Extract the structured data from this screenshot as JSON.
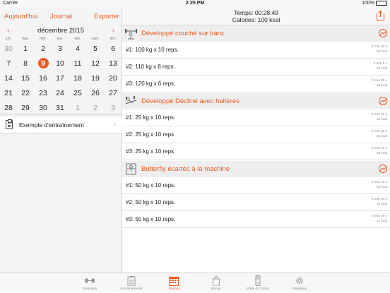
{
  "status": {
    "carrier": "Carrier",
    "time": "2:25 PM",
    "battery": "100%"
  },
  "left_nav": {
    "today": "Aujourd'hui",
    "journal": "Journal",
    "export": "Exporter"
  },
  "calendar": {
    "month": "décembre 2015",
    "weekdays": [
      "lun.",
      "mar.",
      "mer.",
      "jeu.",
      "ven.",
      "sam.",
      "dim."
    ],
    "weeks": [
      [
        "30",
        "1",
        "2",
        "3",
        "4",
        "5",
        "6"
      ],
      [
        "7",
        "8",
        "9",
        "10",
        "11",
        "12",
        "13"
      ],
      [
        "14",
        "15",
        "16",
        "17",
        "18",
        "19",
        "20"
      ],
      [
        "21",
        "22",
        "23",
        "24",
        "25",
        "26",
        "27"
      ],
      [
        "28",
        "29",
        "30",
        "31",
        "1",
        "2",
        "3"
      ]
    ],
    "muted_cells": [
      "0-0",
      "4-4",
      "4-5",
      "4-6"
    ],
    "today_cell": "1-2",
    "dot_cell": "1-2"
  },
  "workout_template": {
    "label": "Exemple d'entraînement"
  },
  "summary": {
    "time": "Temps: 00:28:49",
    "calories": "Calories: 100 kcal"
  },
  "exercises": [
    {
      "name": "Développé couché sur banc",
      "sets": [
        {
          "text": "#1: 100 kg x 10 reps.",
          "duration": "3 min 20 s",
          "kcal": "10 kcal"
        },
        {
          "text": "#2: 110 kg x 8 reps.",
          "duration": "4 min 5 s",
          "kcal": "12 kcal"
        },
        {
          "text": "#3: 120 kg x 6 reps.",
          "duration": "4 min 35 s",
          "kcal": "13 kcal"
        }
      ]
    },
    {
      "name": "Développé Décliné avec haltères",
      "sets": [
        {
          "text": "#1: 25 kg x 10 reps.",
          "duration": "2 min 25 s",
          "kcal": "10 kcal"
        },
        {
          "text": "#2: 25 kg x 10 reps.",
          "duration": "2 min 35 s",
          "kcal": "10 kcal"
        },
        {
          "text": "#3: 25 kg x 10 reps.",
          "duration": "2 min 45 s",
          "kcal": "10 kcal"
        }
      ]
    },
    {
      "name": "Butterfly écartés à la machine",
      "sets": [
        {
          "text": "#1: 50 kg x 10 reps.",
          "duration": "2 min 25 s",
          "kcal": "10 kcal"
        },
        {
          "text": "#2: 50 kg x 10 reps.",
          "duration": "2 min 55 s",
          "kcal": "11 kcal"
        },
        {
          "text": "#3: 50 kg x 10 reps.",
          "duration": "3 min 49 s",
          "kcal": "12 kcal"
        }
      ]
    }
  ],
  "tabs": [
    {
      "label": "Exercices",
      "icon": "dumbbell-icon"
    },
    {
      "label": "Entraînements",
      "icon": "clipboard-icon"
    },
    {
      "label": "Journal",
      "icon": "calendar-icon",
      "active": true
    },
    {
      "label": "Bonus",
      "icon": "bag-icon"
    },
    {
      "label": "Stats du Corps",
      "icon": "scale-icon"
    },
    {
      "label": "Réglages",
      "icon": "gear-icon"
    }
  ],
  "colors": {
    "accent": "#ef5a24",
    "panel": "#f4f4f4",
    "header": "#eeeeee"
  }
}
